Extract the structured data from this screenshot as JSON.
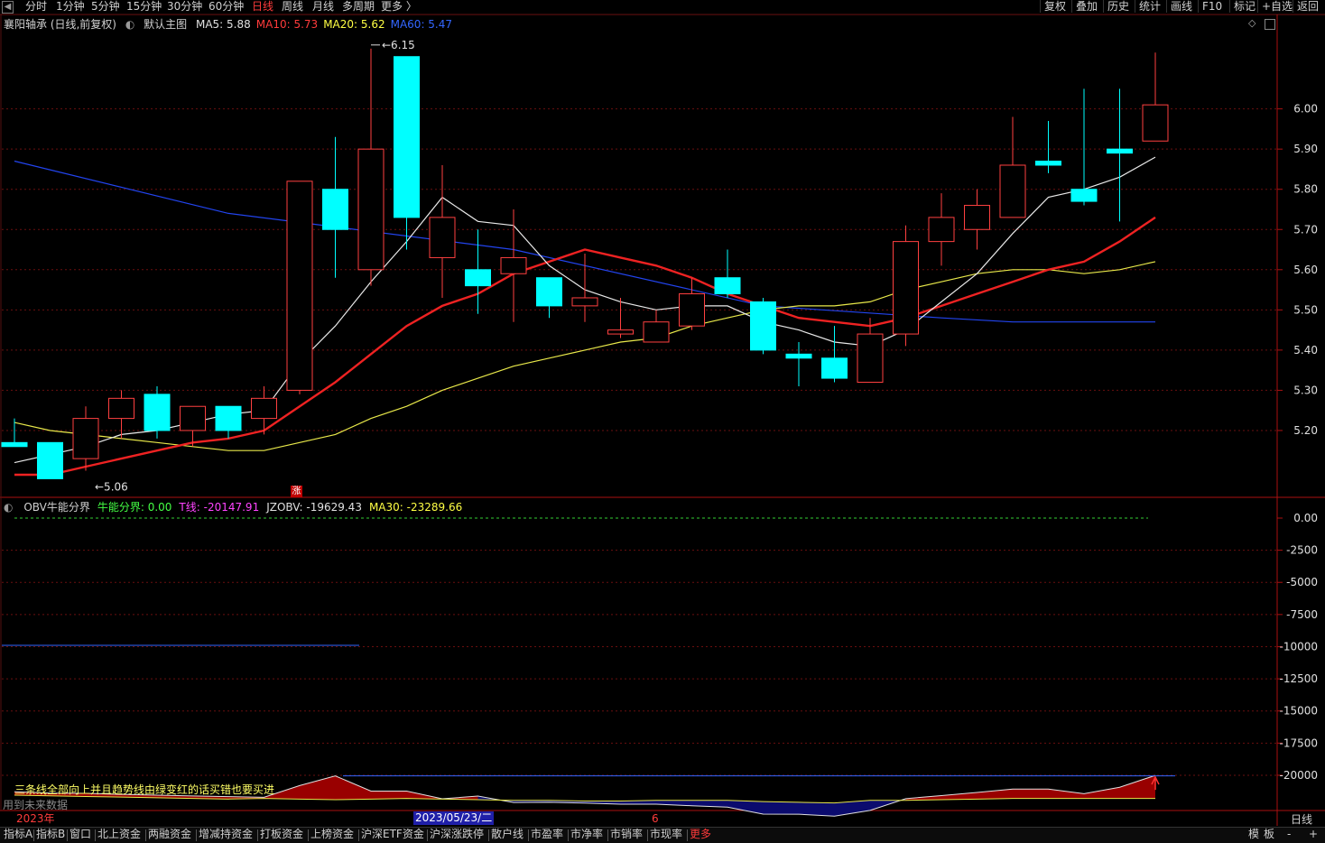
{
  "toolbar": {
    "periods": [
      "分时",
      "1分钟",
      "5分钟",
      "15分钟",
      "30分钟",
      "60分钟",
      "日线",
      "周线",
      "月线",
      "多周期",
      "更多 〉"
    ],
    "active_period": "日线",
    "tools": [
      "复权",
      "叠加",
      "历史",
      "统计",
      "画线",
      "F10",
      "标记",
      "+自选",
      "返回"
    ]
  },
  "main": {
    "stock": "襄阳轴承 (日线,前复权)",
    "template": "默认主图",
    "ma_labels": [
      {
        "text": "MA5: 5.88",
        "color": "#e0e0e0"
      },
      {
        "text": "MA10: 5.73",
        "color": "#ff3b3b"
      },
      {
        "text": "MA20: 5.62",
        "color": "#ffff44"
      },
      {
        "text": "MA60: 5.47",
        "color": "#3366ff"
      }
    ],
    "high_label": "6.15",
    "low_label": "5.06",
    "zhang": "涨"
  },
  "obv": {
    "labels": [
      {
        "text": "OBV牛能分界",
        "color": "#d0d0d0"
      },
      {
        "text": "牛能分界: 0.00",
        "color": "#44ff44"
      },
      {
        "text": "T线: -20147.91",
        "color": "#ff44ff"
      },
      {
        "text": "JZOBV: -19629.43",
        "color": "#e0e0e0"
      },
      {
        "text": "MA30: -23289.66",
        "color": "#ffff44"
      }
    ],
    "note": "三条线全部向上并且趋势线由绿变红的话买错也要买进",
    "note2": "用到未来数据"
  },
  "dates": {
    "year": "2023年",
    "cursor": "2023/05/23/二",
    "tick": "6",
    "right_label": "日线"
  },
  "bottom_tabs": [
    "指标A",
    "指标B",
    "窗口",
    "北上资金",
    "两融资金",
    "增减持资金",
    "打板资金",
    "上榜资金",
    "沪深ETF资金",
    "沪深涨跌停",
    "散户线",
    "市盈率",
    "市净率",
    "市销率",
    "市现率",
    "更多"
  ],
  "bottom_right": [
    "模",
    "板",
    "-",
    "+"
  ],
  "chart_data": [
    {
      "type": "candlestick",
      "title": "襄阳轴承 (日线,前复权)",
      "y_ticks": [
        6.0,
        5.9,
        5.8,
        5.7,
        5.6,
        5.5,
        5.4,
        5.3,
        5.2
      ],
      "ylim": [
        5.045,
        6.19
      ],
      "candles": [
        {
          "o": 5.17,
          "h": 5.23,
          "l": 5.16,
          "c": 5.16
        },
        {
          "o": 5.17,
          "h": 5.17,
          "l": 5.08,
          "c": 5.08
        },
        {
          "o": 5.13,
          "h": 5.26,
          "l": 5.1,
          "c": 5.23
        },
        {
          "o": 5.23,
          "h": 5.3,
          "l": 5.18,
          "c": 5.28
        },
        {
          "o": 5.29,
          "h": 5.31,
          "l": 5.18,
          "c": 5.2
        },
        {
          "o": 5.2,
          "h": 5.26,
          "l": 5.16,
          "c": 5.26
        },
        {
          "o": 5.26,
          "h": 5.26,
          "l": 5.18,
          "c": 5.2
        },
        {
          "o": 5.23,
          "h": 5.31,
          "l": 5.19,
          "c": 5.28
        },
        {
          "o": 5.3,
          "h": 5.82,
          "l": 5.29,
          "c": 5.82
        },
        {
          "o": 5.8,
          "h": 5.93,
          "l": 5.58,
          "c": 5.7
        },
        {
          "o": 5.6,
          "h": 6.15,
          "l": 5.56,
          "c": 5.9
        },
        {
          "o": 6.13,
          "h": 6.13,
          "l": 5.65,
          "c": 5.73
        },
        {
          "o": 5.63,
          "h": 5.86,
          "l": 5.53,
          "c": 5.73
        },
        {
          "o": 5.6,
          "h": 5.7,
          "l": 5.49,
          "c": 5.56
        },
        {
          "o": 5.59,
          "h": 5.75,
          "l": 5.47,
          "c": 5.63
        },
        {
          "o": 5.58,
          "h": 5.58,
          "l": 5.48,
          "c": 5.51
        },
        {
          "o": 5.51,
          "h": 5.64,
          "l": 5.47,
          "c": 5.53
        },
        {
          "o": 5.44,
          "h": 5.53,
          "l": 5.43,
          "c": 5.45
        },
        {
          "o": 5.42,
          "h": 5.5,
          "l": 5.42,
          "c": 5.47
        },
        {
          "o": 5.46,
          "h": 5.58,
          "l": 5.45,
          "c": 5.54
        },
        {
          "o": 5.58,
          "h": 5.65,
          "l": 5.53,
          "c": 5.54
        },
        {
          "o": 5.52,
          "h": 5.53,
          "l": 5.39,
          "c": 5.4
        },
        {
          "o": 5.39,
          "h": 5.42,
          "l": 5.31,
          "c": 5.38
        },
        {
          "o": 5.38,
          "h": 5.46,
          "l": 5.32,
          "c": 5.33
        },
        {
          "o": 5.32,
          "h": 5.48,
          "l": 5.32,
          "c": 5.44
        },
        {
          "o": 5.44,
          "h": 5.71,
          "l": 5.41,
          "c": 5.67
        },
        {
          "o": 5.67,
          "h": 5.79,
          "l": 5.61,
          "c": 5.73
        },
        {
          "o": 5.7,
          "h": 5.8,
          "l": 5.65,
          "c": 5.76
        },
        {
          "o": 5.73,
          "h": 5.98,
          "l": 5.73,
          "c": 5.86
        },
        {
          "o": 5.87,
          "h": 5.97,
          "l": 5.84,
          "c": 5.86
        },
        {
          "o": 5.8,
          "h": 6.05,
          "l": 5.76,
          "c": 5.77
        },
        {
          "o": 5.9,
          "h": 6.05,
          "l": 5.72,
          "c": 5.89
        },
        {
          "o": 5.92,
          "h": 6.14,
          "l": 5.92,
          "c": 6.01
        }
      ],
      "ma5": [
        5.12,
        5.14,
        5.16,
        5.19,
        5.2,
        5.22,
        5.24,
        5.25,
        5.37,
        5.46,
        5.57,
        5.67,
        5.78,
        5.72,
        5.71,
        5.61,
        5.55,
        5.52,
        5.5,
        5.51,
        5.51,
        5.47,
        5.45,
        5.42,
        5.41,
        5.45,
        5.52,
        5.59,
        5.69,
        5.78,
        5.8,
        5.83,
        5.88
      ],
      "ma10": [
        5.09,
        5.09,
        5.11,
        5.13,
        5.15,
        5.17,
        5.18,
        5.2,
        5.26,
        5.32,
        5.39,
        5.46,
        5.51,
        5.54,
        5.59,
        5.62,
        5.65,
        5.63,
        5.61,
        5.58,
        5.54,
        5.51,
        5.48,
        5.47,
        5.46,
        5.48,
        5.51,
        5.54,
        5.57,
        5.6,
        5.62,
        5.67,
        5.73
      ],
      "ma20": [
        5.22,
        5.2,
        5.19,
        5.18,
        5.17,
        5.16,
        5.15,
        5.15,
        5.17,
        5.19,
        5.23,
        5.26,
        5.3,
        5.33,
        5.36,
        5.38,
        5.4,
        5.42,
        5.43,
        5.46,
        5.48,
        5.5,
        5.51,
        5.51,
        5.52,
        5.55,
        5.57,
        5.59,
        5.6,
        5.6,
        5.59,
        5.6,
        5.62
      ],
      "ma60_x": [
        0,
        6,
        14,
        21,
        26,
        28,
        32
      ],
      "ma60": [
        5.87,
        5.74,
        5.65,
        5.51,
        5.48,
        5.47,
        5.47
      ]
    },
    {
      "type": "area",
      "title": "OBV牛能分界",
      "y_ticks": [
        0,
        -2500,
        -5000,
        -7500,
        -10000,
        -12500,
        -15000,
        -17500,
        -20000
      ],
      "ylim": [
        -22600,
        0
      ],
      "jzobv": [
        -21280,
        -21390,
        -21410,
        -21490,
        -21550,
        -21610,
        -21660,
        -21710,
        -20800,
        -20050,
        -21230,
        -21230,
        -21830,
        -21620,
        -22120,
        -22100,
        -22160,
        -22250,
        -22250,
        -22370,
        -22480,
        -23020,
        -23030,
        -23180,
        -22730,
        -21820,
        -21580,
        -21340,
        -21070,
        -21070,
        -21430,
        -20930,
        -20010
      ],
      "ma30": [
        -21550,
        -21600,
        -21650,
        -21700,
        -21750,
        -21800,
        -21850,
        -21800,
        -21850,
        -21900,
        -21850,
        -21800,
        -21850,
        -21900,
        -21950,
        -21950,
        -22000,
        -22000,
        -21950,
        -21950,
        -21950,
        -22050,
        -22100,
        -22150,
        -21950,
        -21950,
        -21900,
        -21850,
        -21800,
        -21800,
        -21800,
        -21800,
        -21800
      ],
      "blue_top_y": -9900,
      "blue_bottom_y": -20050
    }
  ]
}
